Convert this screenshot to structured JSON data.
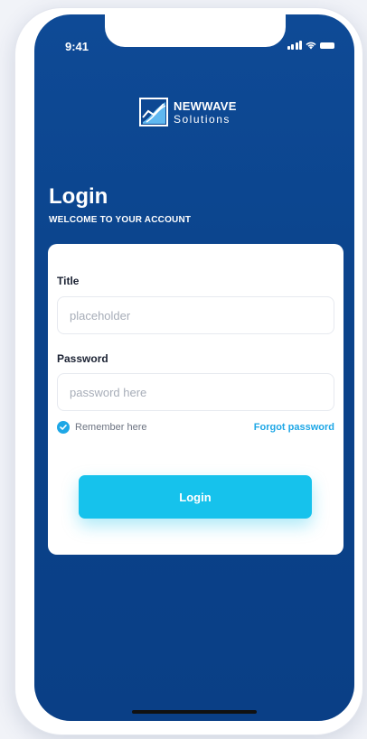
{
  "status": {
    "time": "9:41"
  },
  "brand": {
    "name": "NEWWAVE",
    "sub": "Solutions"
  },
  "login": {
    "title": "Login",
    "subtitle": "WELCOME TO YOUR ACCOUNT"
  },
  "form": {
    "title_label": "Title",
    "title_placeholder": "placeholder",
    "password_label": "Password",
    "password_placeholder": "password here",
    "remember_label": "Remember here",
    "remember_checked": true,
    "forgot_label": "Forgot password",
    "submit_label": "Login"
  },
  "colors": {
    "background": "#0b438b",
    "accent": "#16c2ec",
    "link": "#1ea7e6"
  }
}
